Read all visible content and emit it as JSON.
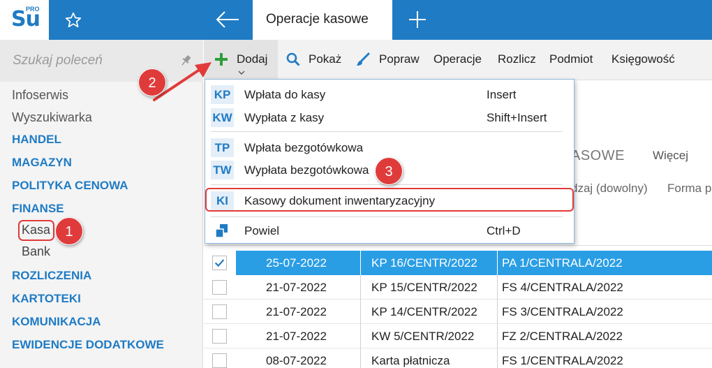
{
  "app": {
    "logo": "Su",
    "logo_badge": "PRO",
    "active_tab": "Operacje kasowe"
  },
  "sidebar": {
    "search_placeholder": "Szukaj poleceń",
    "items": [
      {
        "label": "Infoserwis"
      },
      {
        "label": "Wyszukiwarka"
      },
      {
        "label": "HANDEL"
      },
      {
        "label": "MAGAZYN"
      },
      {
        "label": "POLITYKA CENOWA"
      },
      {
        "label": "FINANSE"
      },
      {
        "label": "Kasa"
      },
      {
        "label": "Bank"
      },
      {
        "label": "ROZLICZENIA"
      },
      {
        "label": "KARTOTEKI"
      },
      {
        "label": "KOMUNIKACJA"
      },
      {
        "label": "EWIDENCJE DODATKOWE"
      }
    ]
  },
  "toolbar": {
    "items": [
      {
        "label": "Dodaj"
      },
      {
        "label": "Pokaż"
      },
      {
        "label": "Popraw"
      },
      {
        "label": "Operacje"
      },
      {
        "label": "Rozlicz"
      },
      {
        "label": "Podmiot"
      },
      {
        "label": "Księgowość"
      }
    ]
  },
  "menu": {
    "items": [
      {
        "code": "KP",
        "label": "Wpłata do kasy",
        "shortcut": "Insert"
      },
      {
        "code": "KW",
        "label": "Wypłata z kasy",
        "shortcut": "Shift+Insert"
      },
      {
        "code": "TP",
        "label": "Wpłata bezgotówkowa",
        "shortcut": ""
      },
      {
        "code": "TW",
        "label": "Wypłata bezgotówkowa",
        "shortcut": ""
      },
      {
        "code": "KI",
        "label": "Kasowy dokument inwentaryzacyjny",
        "shortcut": ""
      },
      {
        "code": "",
        "label": "Powiel",
        "shortcut": "Ctrl+D"
      }
    ]
  },
  "background": {
    "tab_partial": "ASOWE",
    "tab_more": "Więcej",
    "col_rodzaj": "dzaj (dowolny)",
    "col_forma": "Forma p"
  },
  "table": {
    "rows": [
      {
        "date": "25-07-2022",
        "number": "KP 16/CENTR/2022",
        "doc": "PA 1/CENTRALA/2022",
        "selected": true
      },
      {
        "date": "21-07-2022",
        "number": "KP 15/CENTR/2022",
        "doc": "FS 4/CENTRALA/2022",
        "selected": false
      },
      {
        "date": "21-07-2022",
        "number": "KP 14/CENTR/2022",
        "doc": "FS 3/CENTRALA/2022",
        "selected": false
      },
      {
        "date": "21-07-2022",
        "number": "KW 5/CENTR/2022",
        "doc": "FZ 2/CENTRALA/2022",
        "selected": false
      },
      {
        "date": "08-07-2022",
        "number": "Karta płatnicza",
        "doc": "FS 1/CENTRALA/2022",
        "selected": false
      }
    ]
  },
  "annotations": {
    "badge1": "1",
    "badge2": "2",
    "badge3": "3"
  },
  "colors": {
    "brand_blue": "#1f7bc4",
    "selection_blue": "#2a9ee5",
    "annotation_red": "#e03b3b",
    "add_green": "#2e9e3a"
  }
}
